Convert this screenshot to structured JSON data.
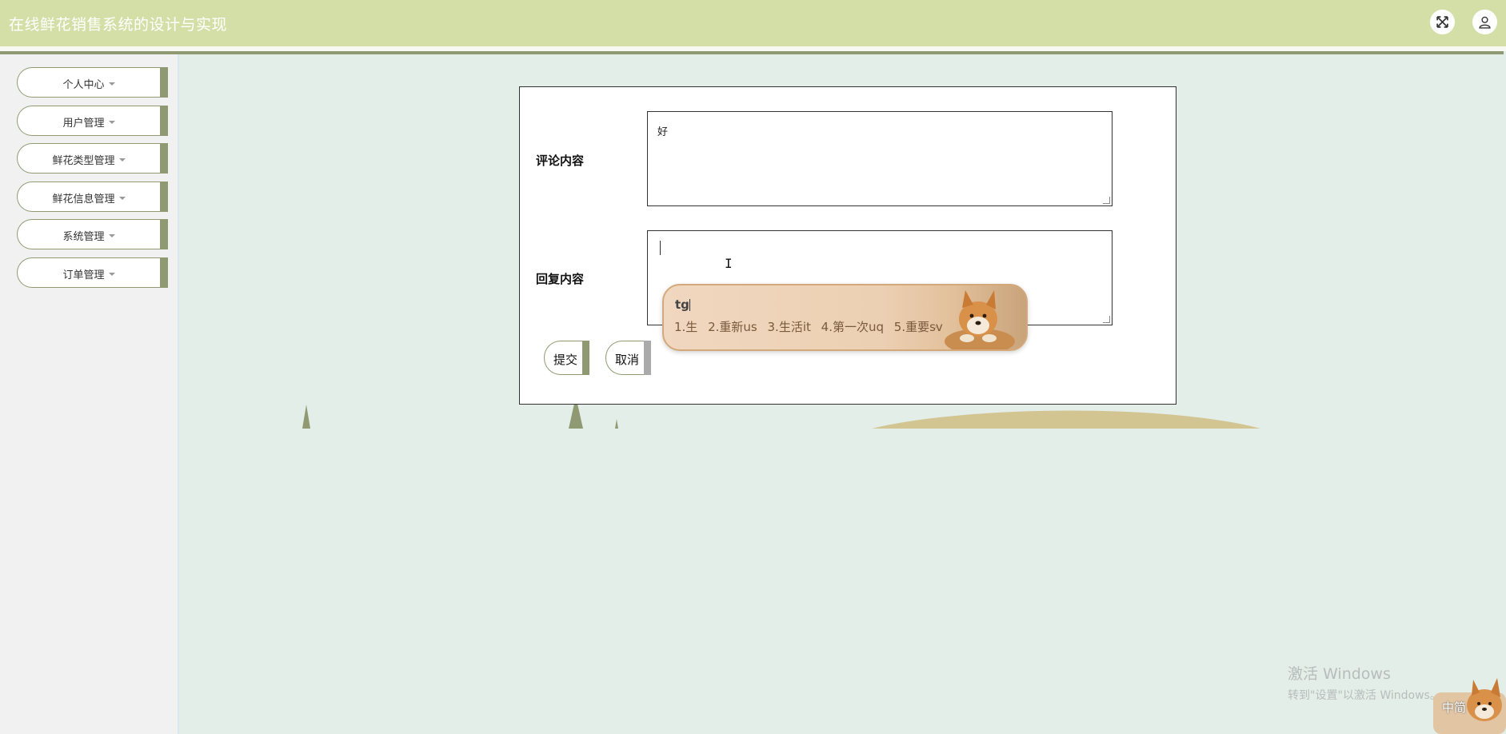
{
  "app": {
    "title": "在线鲜花销售系统的设计与实现"
  },
  "header": {
    "fullscreen_icon": "expand-icon",
    "user_icon": "user-icon"
  },
  "sidebar": {
    "items": [
      {
        "label": "个人中心"
      },
      {
        "label": "用户管理"
      },
      {
        "label": "鲜花类型管理"
      },
      {
        "label": "鲜花信息管理"
      },
      {
        "label": "系统管理"
      },
      {
        "label": "订单管理"
      }
    ]
  },
  "form": {
    "comment_label": "评论内容",
    "comment_value": "好",
    "reply_label": "回复内容",
    "reply_value": "",
    "submit_label": "提交",
    "cancel_label": "取消"
  },
  "ime": {
    "composition": "tg",
    "candidates": [
      "1.生",
      "2.重新us",
      "3.生活it",
      "4.第一次uq",
      "5.重要sv"
    ],
    "next_arrow": "›"
  },
  "watermark": {
    "line1": "激活 Windows",
    "line2": "转到\"设置\"以激活 Windows。"
  },
  "tray": {
    "ime_mode": "中简"
  },
  "colors": {
    "header_bg": "#d3dfa7",
    "accent": "#8f9a72",
    "page_bg": "#e3eee9",
    "sidebar_bg": "#f1f1f1",
    "cancel_bar": "#aaaaaa"
  }
}
